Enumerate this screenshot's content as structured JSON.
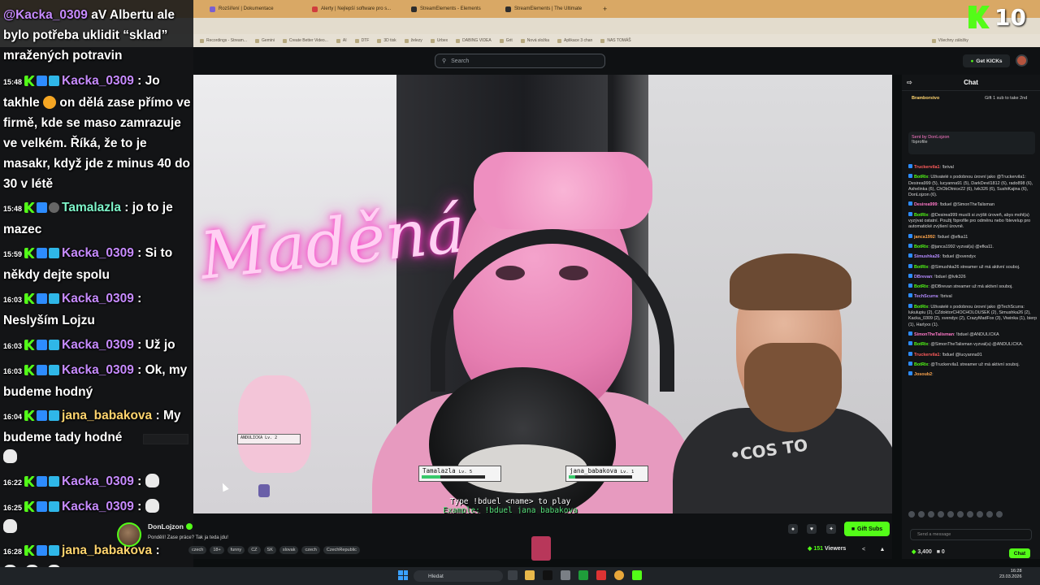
{
  "browser": {
    "tabs": [
      {
        "label": "Rozšíření | Dokumentace"
      },
      {
        "label": "Alerty | Nejlepší software pro s..."
      },
      {
        "label": "StreamElements - Elements"
      },
      {
        "label": "StreamElements | The Ultimate"
      }
    ],
    "bookmarks": [
      "Recordings - Stream...",
      "Gemini",
      "Create Better Video...",
      "AI",
      "DTF",
      "3D tisk",
      "železy",
      "Urbex",
      "DABING VIDEA",
      "Grit",
      "Nová složka",
      "Aplikace 3 chan",
      "NAS TOMÁŠ"
    ],
    "bookmarks_right": "Všechny záložky"
  },
  "site": {
    "search_placeholder": "Search",
    "get_kicks_label": "Get KICKs"
  },
  "overlay": {
    "kick_counter": "10",
    "game": {
      "players": [
        {
          "name": "Tamalazla",
          "level": "Lv. 5",
          "hp": 0.3
        },
        {
          "name": "jana_babakova",
          "level": "Lv. 1",
          "hp": 0.1
        }
      ],
      "small_player": {
        "name": "ANDULICKA",
        "level": "Lv. 2"
      },
      "instruction": "Type !bduel <name> to play",
      "example": "Example: !bduel jana_babakova"
    },
    "neon_sign": "Maděná"
  },
  "left_chat": {
    "messages": [
      {
        "time": "",
        "user": "@Kacka_0309",
        "user_class": "u-kacka",
        "text": " aV Albertu ale bylo potřeba uklidit “sklad” mražených potravin",
        "badges": false
      },
      {
        "time": "15:48",
        "user": "Kacka_0309",
        "user_class": "u-kacka",
        "text": " : Jo takhle ",
        "text2": " on dělá zase přímo ve firmě, kde se maso zamrazuje ve velkém. Říká, že to je masakr, když jde z minus 40 do 30 v létě",
        "badges": true
      },
      {
        "time": "15:48",
        "user": "Tamalazla",
        "user_class": "u-tama",
        "text": " : jo to je mazec",
        "badges": true
      },
      {
        "time": "15:59",
        "user": "Kacka_0309",
        "user_class": "u-kacka",
        "text": " : Si to někdy dejte spolu",
        "badges": true
      },
      {
        "time": "16:03",
        "user": "Kacka_0309",
        "user_class": "u-kacka",
        "text": " : Neslyším Lojzu",
        "badges": true
      },
      {
        "time": "16:03",
        "user": "Kacka_0309",
        "user_class": "u-kacka",
        "text": " : Už jo",
        "badges": true
      },
      {
        "time": "16:03",
        "user": "Kacka_0309",
        "user_class": "u-kacka",
        "text": " : Ok, my budeme hodný",
        "badges": true
      },
      {
        "time": "16:04",
        "user": "jana_babakova",
        "user_class": "u-jana",
        "text": " : My budeme tady hodné",
        "badges": true
      },
      {
        "time": "16:22",
        "user": "Kacka_0309",
        "user_class": "u-kacka",
        "text": " : ",
        "badges": true
      },
      {
        "time": "16:25",
        "user": "Kacka_0309",
        "user_class": "u-kacka",
        "text": " : ",
        "badges": true
      },
      {
        "time": "16:28",
        "user": "jana_babakova",
        "user_class": "u-jana",
        "text": " : ",
        "badges": true
      }
    ]
  },
  "stream": {
    "streamer": "DonLojzon",
    "title": "Pondělí! Zase práce? Tak ja teda jdu!",
    "tags": [
      "czech",
      "18+",
      "funny",
      "CZ",
      "SK",
      "slovak",
      "czech",
      "CzechRepublic"
    ],
    "viewers": "151",
    "viewers_label": "Viewers",
    "gift_subs_label": "Gift Subs"
  },
  "right_chat": {
    "title": "Chat",
    "pinned": {
      "user": "Bramborstvo",
      "text": "Gift 1 sub to take 2nd"
    },
    "sent_by": {
      "label": "Sent by",
      "user": "DonLojzon",
      "text": "!bprofile"
    },
    "lines": [
      {
        "user": "Truckervila1",
        "cls": "cn-red",
        "text": ": !brival"
      },
      {
        "user": "BotRix",
        "cls": "cn-green",
        "text": ": Uživatelé s podobnou úrovní jako @Truckervila1: Desirea999 (5), lucyanna91 (5), DarkDevil1812 (6), rado898 (6), Ashelinka (6), ChObOtnice22 (6), lvik326 (6), SushiKajina (6), DonLojzon (6)."
      },
      {
        "user": "Desirea999",
        "cls": "cn-pink",
        "text": ": !bduel @SimonTheTalisman"
      },
      {
        "user": "BotRix",
        "cls": "cn-green",
        "text": ": @Desirea999 musíš si zvýšit úroveň, abys mohl(a) vyzývat ostatní. Použij !bprofile pro odměnu nebo !blevelup pro automatické zvýšení úrovně."
      },
      {
        "user": "janca1992",
        "cls": "cn-orange",
        "text": ": !bduel @efka11"
      },
      {
        "user": "BotRix",
        "cls": "cn-green",
        "text": ": @janca1992 vyzval(a) @efka11."
      },
      {
        "user": "Simushka26",
        "cls": "cn-purple",
        "text": ": !bduel @xvendyx"
      },
      {
        "user": "BotRix",
        "cls": "cn-green",
        "text": ": @Simushka26 streamer už má aktivní souboj."
      },
      {
        "user": "DBrevan",
        "cls": "cn-purple",
        "text": ": !bduel @lvik326"
      },
      {
        "user": "BotRix",
        "cls": "cn-green",
        "text": ": @DBrevan streamer už má aktivní souboj."
      },
      {
        "user": "TechScurra",
        "cls": "cn-purple",
        "text": ": !brival"
      },
      {
        "user": "BotRix",
        "cls": "cn-green",
        "text": ": Uživatelé s podobnou úrovní jako @TechScurra: lukulupiu (2), CZdoktorCHOCHOLOUSEK (2), Simushka26 (2), Kacka_0309 (2), xvendyx (2), CrazyMadFox (3), Viwinka (1), bierp (1), Harlyxx (1)."
      },
      {
        "user": "SimonTheTalisman",
        "cls": "cn-pink",
        "text": ": !bduel @ANDULICKA"
      },
      {
        "user": "BotRix",
        "cls": "cn-green",
        "text": ": @SimonTheTalisman vyzval(a) @ANDULICKA."
      },
      {
        "user": "Truckervila1",
        "cls": "cn-red",
        "text": ": !bduel @lucyanna91"
      },
      {
        "user": "BotRix",
        "cls": "cn-green",
        "text": ": @Truckervila1 streamer už má aktivní souboj."
      },
      {
        "user": "Josoub2",
        "cls": "cn-orange",
        "text": ":"
      }
    ],
    "input_placeholder": "Send a message",
    "points": "3,400",
    "zero": "0",
    "chat_button": "Chat"
  },
  "taskbar": {
    "search_label": "Hledat",
    "time": "16:28",
    "date": "23.03.2026"
  }
}
